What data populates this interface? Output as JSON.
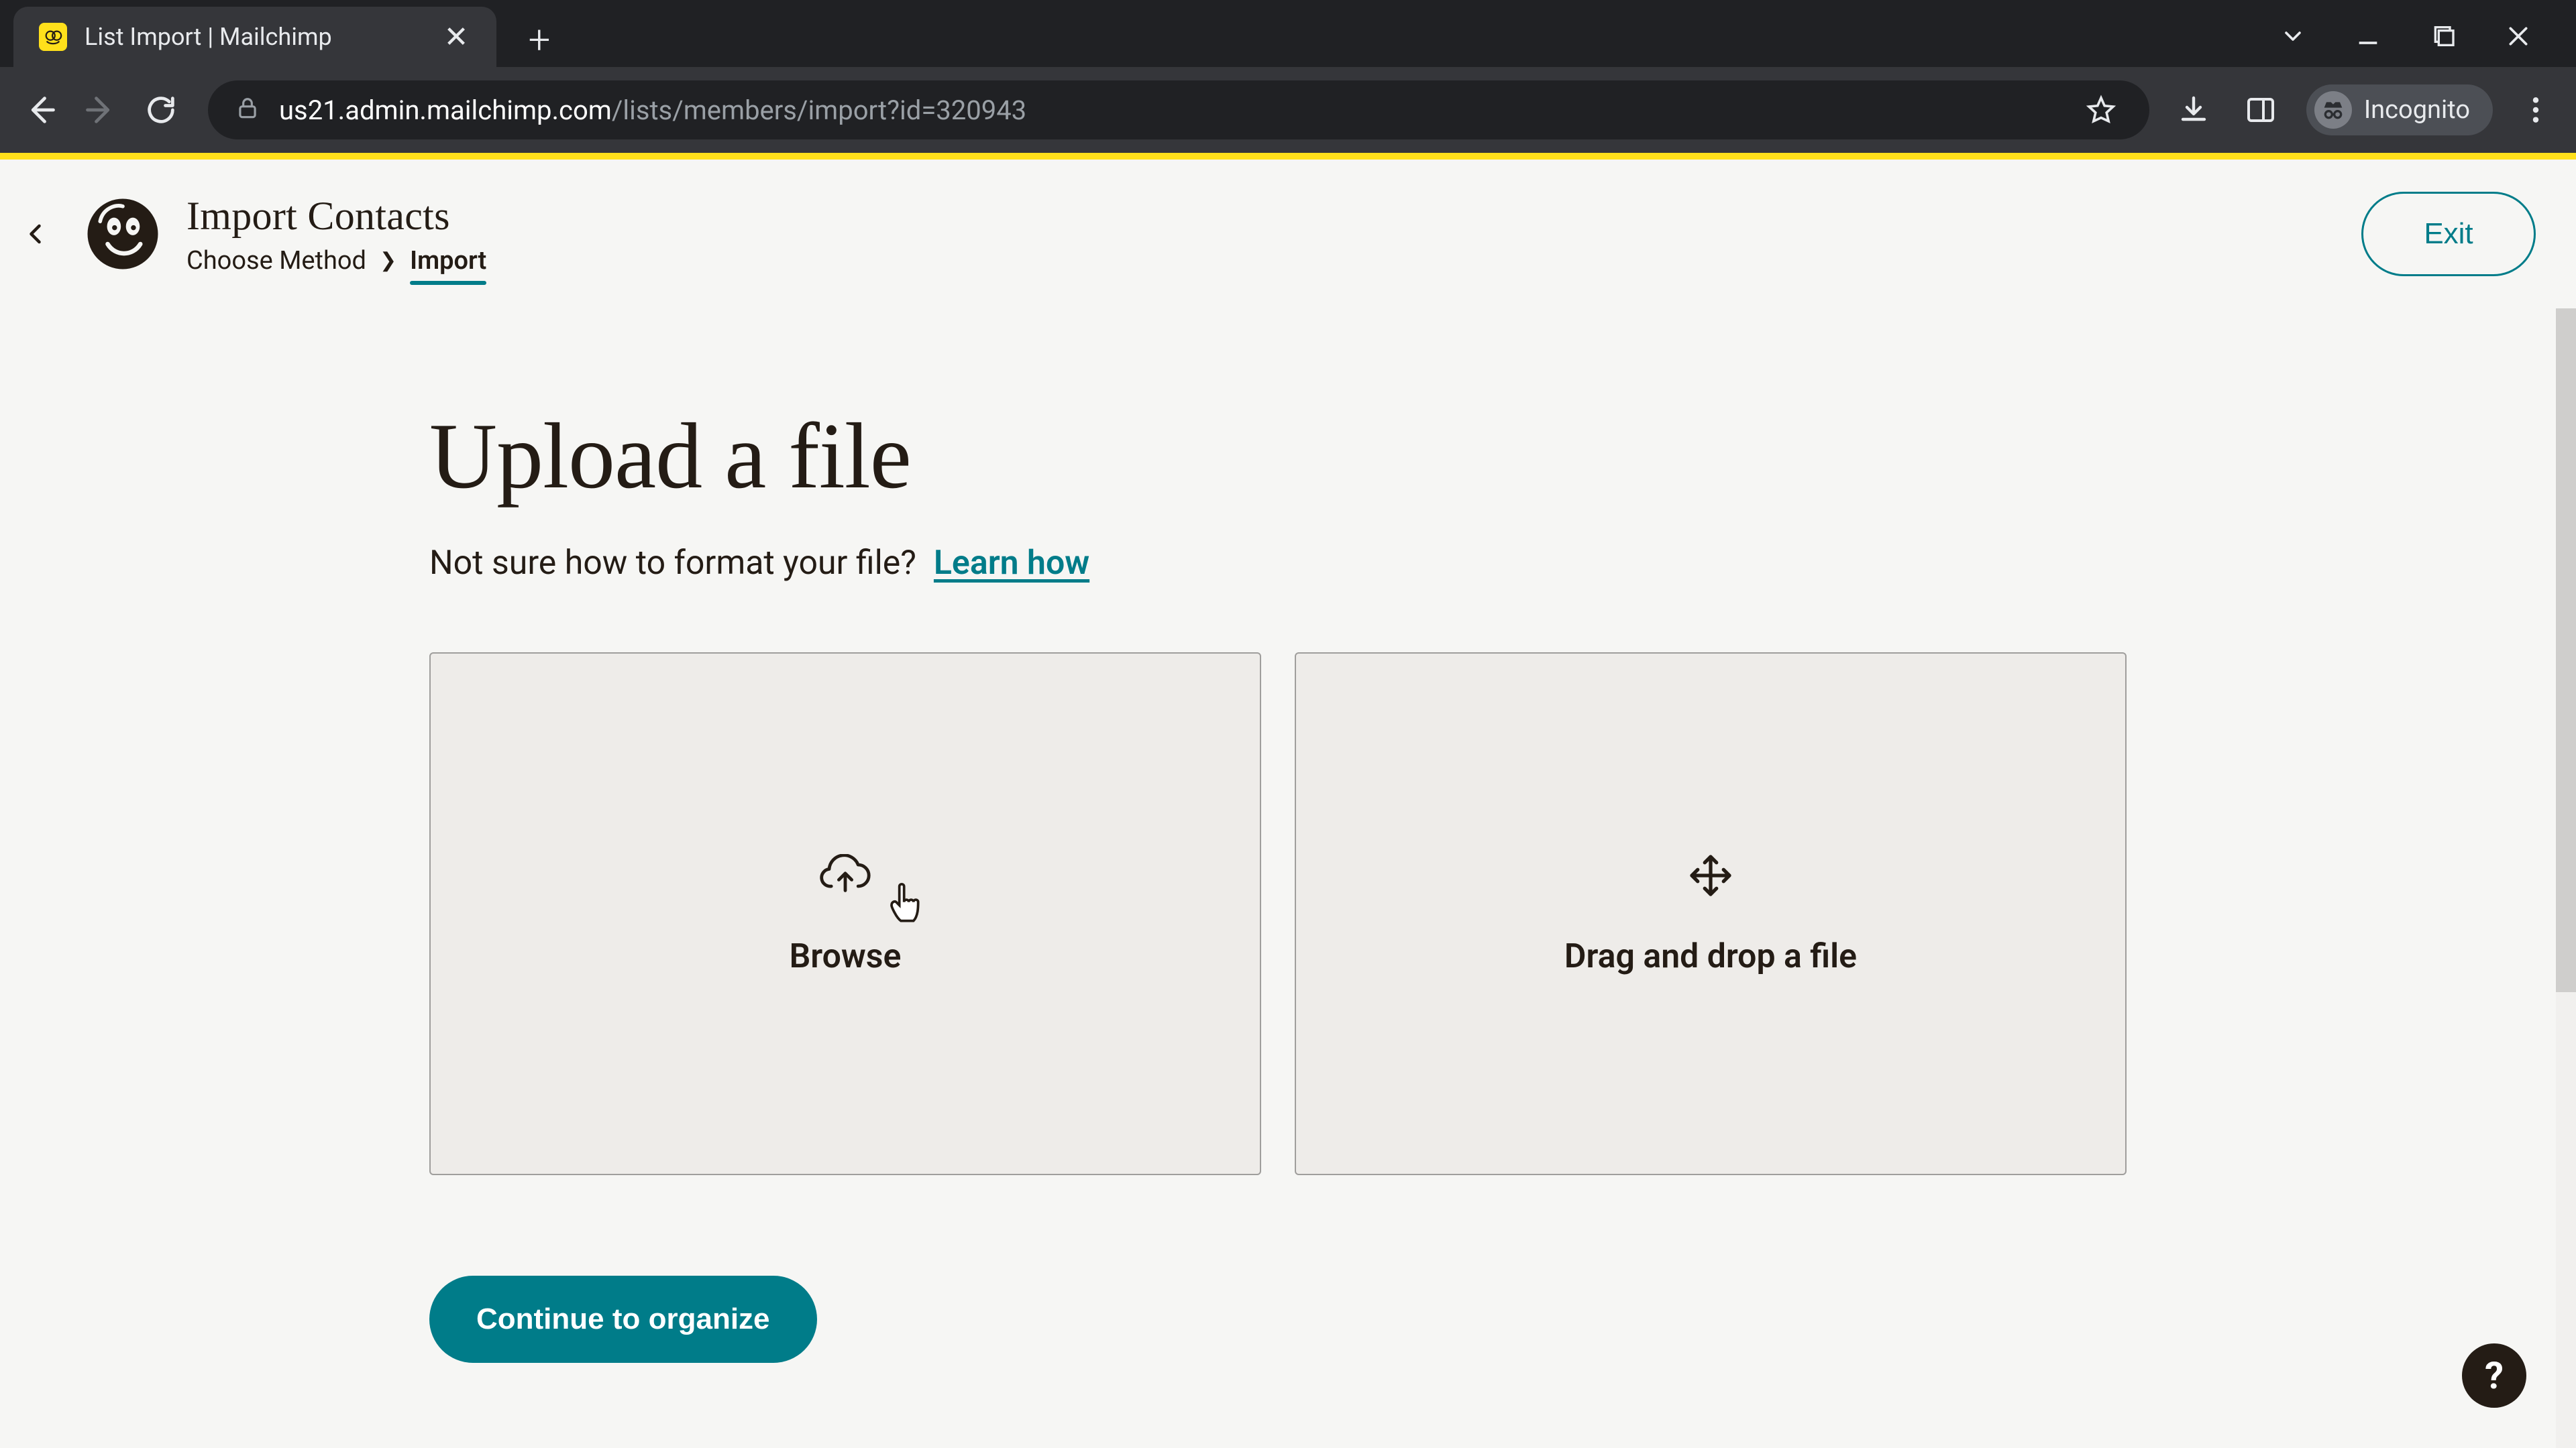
{
  "browser": {
    "tab_title": "List Import | Mailchimp",
    "url_host": "us21.admin.mailchimp.com",
    "url_path": "/lists/members/import?id=320943",
    "incognito_label": "Incognito"
  },
  "header": {
    "page_title": "Import Contacts",
    "breadcrumbs": {
      "step1": "Choose Method",
      "step2": "Import"
    },
    "exit_label": "Exit"
  },
  "content": {
    "heading": "Upload a file",
    "subhelp_text": "Not sure how to format your file?",
    "learn_link": "Learn how",
    "browse_label": "Browse",
    "dragdrop_label": "Drag and drop a file",
    "cta_label": "Continue to organize",
    "help_fab": "?"
  },
  "colors": {
    "accent": "#007c89",
    "brand_yellow": "#ffe01b",
    "text": "#241c15"
  }
}
